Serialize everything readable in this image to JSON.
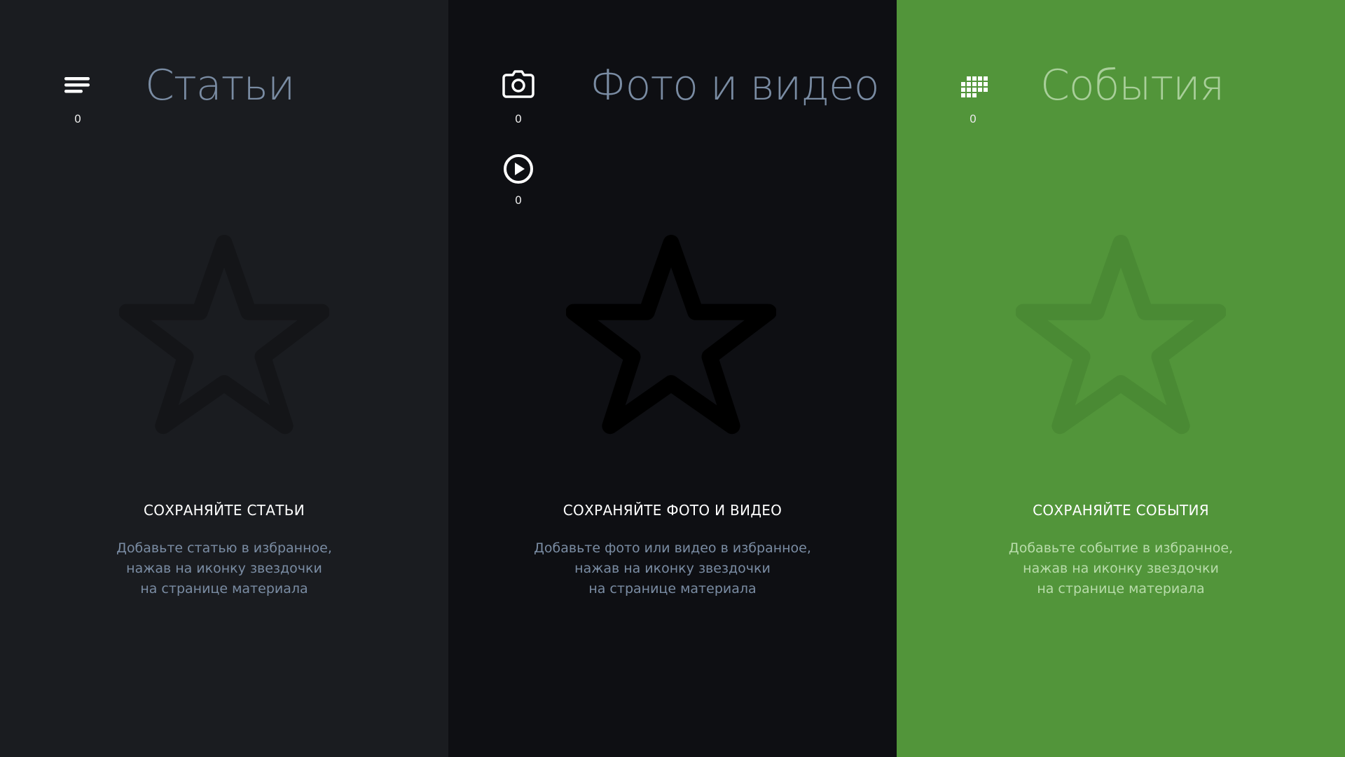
{
  "panels": {
    "articles": {
      "title": "Статьи",
      "filters": [
        {
          "icon": "list-icon",
          "count": "0"
        }
      ],
      "empty_title": "СОХРАНЯЙТЕ СТАТЬИ",
      "empty_desc": [
        "Добавьте статью в избранное,",
        "нажав на иконку звездочки",
        "на странице материала"
      ],
      "background": "#1a1c20"
    },
    "media": {
      "title": "Фото и видео",
      "filters": [
        {
          "icon": "camera-icon",
          "count": "0"
        },
        {
          "icon": "play-icon",
          "count": "0"
        }
      ],
      "empty_title": "СОХРАНЯЙТЕ ФОТО И ВИДЕО",
      "empty_desc": [
        "Добавьте фото или видео в избранное,",
        "нажав на иконку звездочки",
        "на странице материала"
      ],
      "background": "#0e0f13"
    },
    "events": {
      "title": "События",
      "filters": [
        {
          "icon": "grid-calendar-icon",
          "count": "0"
        }
      ],
      "empty_title": "СОХРАНЯЙТЕ СОБЫТИЯ",
      "empty_desc": [
        "Добавьте событие в избранное,",
        "нажав на иконку звездочки",
        "на странице материала"
      ],
      "background": "#52953a"
    }
  },
  "icons": {
    "star": "star-outline-icon"
  }
}
